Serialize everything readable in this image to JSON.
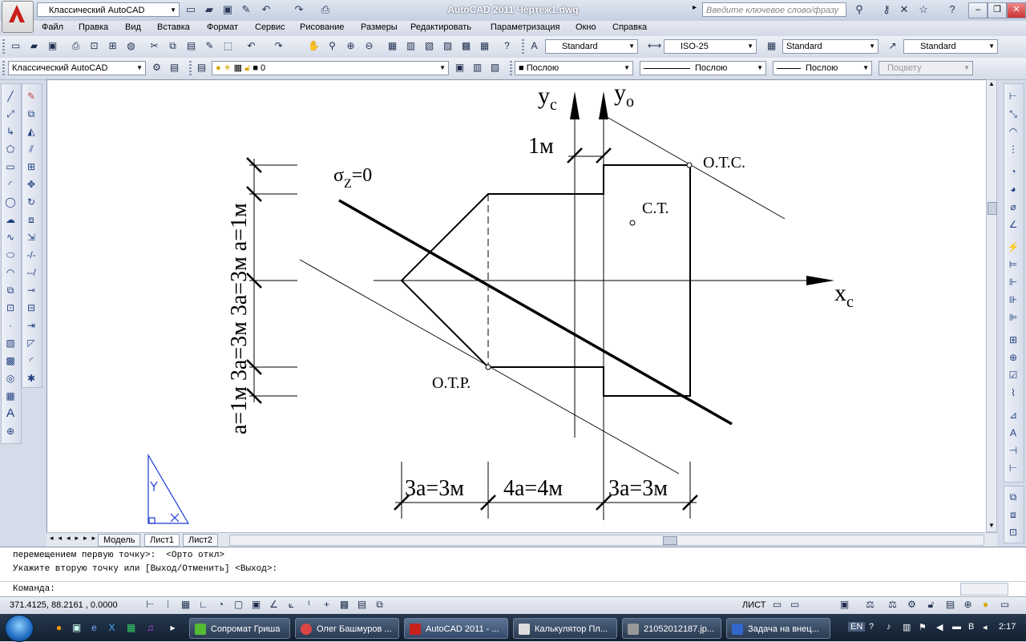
{
  "app": {
    "workspace": "Классический AutoCAD",
    "title": "AutoCAD 2011  Чертеж1.dwg",
    "search_placeholder": "Введите ключевое слово/фразу"
  },
  "menu": [
    "Файл",
    "Правка",
    "Вид",
    "Вставка",
    "Формат",
    "Сервис",
    "Рисование",
    "Размеры",
    "Редактировать",
    "Параметризация",
    "Окно",
    "Справка"
  ],
  "styles": {
    "text_style": "Standard",
    "dim_style": "ISO-25",
    "table_style": "Standard",
    "multileader_style": "Standard"
  },
  "workspace_combo": "Классический AutoCAD",
  "layer": {
    "name": "0"
  },
  "properties": {
    "color": "Послою",
    "linetype": "Послою",
    "lineweight": "Послою",
    "plotstyle": "Поцвету"
  },
  "drawing": {
    "sigma_label": "σ",
    "sigma_sub": "Z",
    "sigma_rest": "=0",
    "yc": "y",
    "yc_sub": "c",
    "yo": "y",
    "yo_sub": "o",
    "xc": "x",
    "xc_sub": "c",
    "one_m": "1м",
    "otc": "О.Т.С.",
    "ct": "С.Т.",
    "otr": "О.Т.Р.",
    "left_dim": "a=1м 3a=3м 3a=3м a=1м",
    "bottom_dim_1": "3a=3м",
    "bottom_dim_2": "4a=4м",
    "bottom_dim_3": "3a=3м"
  },
  "tabs": [
    "Модель",
    "Лист1",
    "Лист2"
  ],
  "command": {
    "line1": "перемещением первую точку>:  <Орто откл>",
    "line2": "Укажите вторую точку или [Выход/Отменить] <Выход>:",
    "prompt": "Команда:"
  },
  "status": {
    "coords": "371.4125, 88.2161 , 0.0000",
    "layout_label": "ЛИСТ"
  },
  "taskbar": {
    "items": [
      "Сопромат Гриша",
      "Олег Башмуров ...",
      "AutoCAD 2011 - ...",
      "Калькулятор Пл...",
      "21052012187.jp...",
      "Задача на внец..."
    ],
    "lang": "EN",
    "time": "2:17"
  },
  "colors": {
    "accent": "#c8201b",
    "taskbar": "#1c2b3e",
    "chrome": "#d6dbe9"
  }
}
